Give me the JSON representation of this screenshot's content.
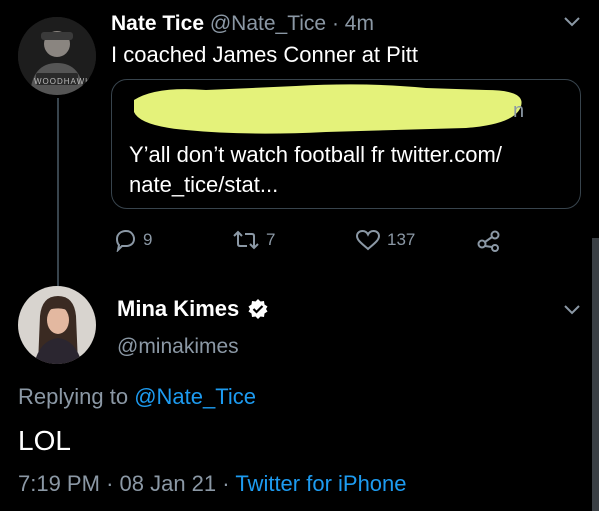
{
  "tweet1": {
    "name": "Nate Tice",
    "handle": "@Nate_Tice",
    "separator": "·",
    "time": "4m",
    "text": "I coached James Conner at Pitt",
    "avatar_text": "WOODHAWKS",
    "quoted": {
      "text_line1": "Y’all don’t watch football fr twitter.com/",
      "text_line2": "nate_tice/stat..."
    },
    "actions": {
      "replies": "9",
      "retweets": "7",
      "likes": "137"
    }
  },
  "tweet2": {
    "name": "Mina Kimes",
    "handle": "@minakimes",
    "replying_prefix": "Replying to",
    "replying_to": "@Nate_Tice",
    "text": "LOL",
    "time": "7:19 PM",
    "date": "08 Jan 21",
    "meta_sep": "·",
    "source": "Twitter for iPhone"
  },
  "colors": {
    "background": "#000000",
    "text": "#e7e9ea",
    "muted": "#8b98a5",
    "link": "#1d9bf0",
    "border": "#38444d",
    "redaction": "#e4f27a",
    "verified": "#ffffff"
  }
}
